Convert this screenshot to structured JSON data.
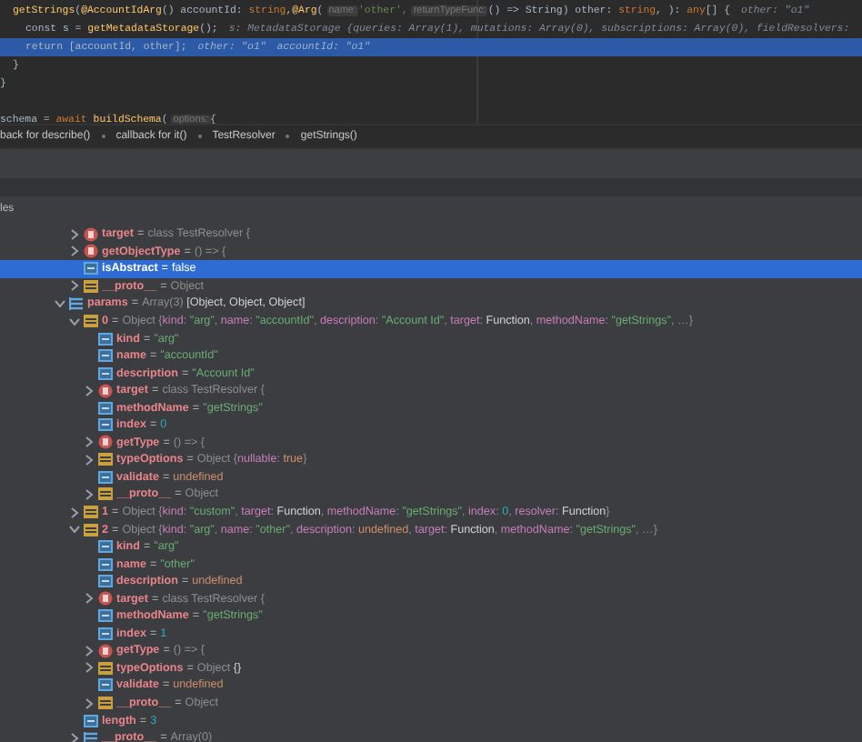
{
  "editor": {
    "lines": [
      {
        "current": false,
        "segments": [
          {
            "kind": "fn",
            "text": "getStrings"
          },
          {
            "kind": "plain",
            "text": "("
          },
          {
            "kind": "fn",
            "text": "@AccountIdArg"
          },
          {
            "kind": "plain",
            "text": "() accountId: "
          },
          {
            "kind": "kw",
            "text": "string"
          },
          {
            "kind": "plain",
            "text": ","
          },
          {
            "kind": "fn",
            "text": "@Arg"
          },
          {
            "kind": "plain",
            "text": "("
          },
          {
            "kind": "hint",
            "text": "name:"
          },
          {
            "kind": "str",
            "text": "'other',"
          },
          {
            "kind": "hint",
            "text": "returnTypeFunc:"
          },
          {
            "kind": "plain",
            "text": "() => String) other: "
          },
          {
            "kind": "kw",
            "text": "string"
          },
          {
            "kind": "plain",
            "text": ", ): "
          },
          {
            "kind": "kw",
            "text": "any"
          },
          {
            "kind": "plain",
            "text": "[] {"
          },
          {
            "kind": "inline",
            "text": "other: \"o1\""
          }
        ]
      },
      {
        "current": false,
        "segments": [
          {
            "kind": "plain",
            "text": "const s = "
          },
          {
            "kind": "fn",
            "text": "getMetadataStorage"
          },
          {
            "kind": "plain",
            "text": "();"
          },
          {
            "kind": "inline",
            "text": "s: MetadataStorage {queries: Array(1), mutations: Array(0), subscriptions: Array(0), fieldResolvers:"
          }
        ]
      },
      {
        "current": true,
        "segments": [
          {
            "kind": "plain",
            "text": "return [accountId, other];"
          },
          {
            "kind": "inline",
            "text": "other: \"o1\""
          },
          {
            "kind": "inline",
            "text": "accountId: \"o1\""
          }
        ]
      },
      {
        "current": false,
        "segments": [
          {
            "kind": "plain",
            "text": "}"
          }
        ]
      },
      {
        "current": false,
        "segments": [
          {
            "kind": "plain",
            "text": "}"
          }
        ]
      },
      {
        "current": false,
        "blank_before": true,
        "segments": [
          {
            "kind": "plain",
            "text": "schema = "
          },
          {
            "kind": "kw",
            "text": "await"
          },
          {
            "kind": "fn",
            "text": "buildSchema"
          },
          {
            "kind": "plain",
            "text": "("
          },
          {
            "kind": "hint",
            "text": "options:"
          },
          {
            "kind": "plain",
            "text": "{"
          }
        ]
      }
    ]
  },
  "breadcrumbs": [
    "back for describe()",
    "callback for it()",
    "TestResolver",
    "getStrings()"
  ],
  "panel_title": "les",
  "tree": {
    "continued": [
      {
        "name": "target",
        "kind": "function",
        "expanded": false,
        "selected": false,
        "value": [
          {
            "kind": "eq",
            "text": "="
          },
          {
            "kind": "dim",
            "text": "class TestResolver {"
          }
        ]
      },
      {
        "name": "getObjectType",
        "kind": "function",
        "expanded": false,
        "selected": false,
        "value": [
          {
            "kind": "eq",
            "text": "="
          },
          {
            "kind": "dim",
            "text": "() => {"
          }
        ]
      },
      {
        "name": "isAbstract",
        "kind": "field",
        "selected": true,
        "value": [
          {
            "kind": "eq",
            "text": "="
          },
          {
            "kind": "kw",
            "text": "false"
          }
        ]
      },
      {
        "name": "__proto__",
        "kind": "object",
        "expanded": false,
        "selected": false,
        "value": [
          {
            "kind": "eq",
            "text": "="
          },
          {
            "kind": "dim",
            "text": "Object"
          }
        ]
      }
    ],
    "items": [
      {
        "name": "params",
        "kind": "array",
        "expanded": true,
        "selected": false,
        "value": [
          {
            "kind": "eq",
            "text": "="
          },
          {
            "kind": "dim",
            "text": "Array(3) "
          },
          {
            "kind": "plain",
            "text": "[Object, Object, Object]"
          }
        ],
        "children": [
          {
            "name": "0",
            "kind": "object",
            "expanded": true,
            "selected": false,
            "value": [
              {
                "kind": "eq",
                "text": "="
              },
              {
                "kind": "dim",
                "text": "Object {"
              },
              {
                "kind": "key",
                "text": "kind"
              },
              {
                "kind": "dim",
                "text": ": "
              },
              {
                "kind": "str",
                "text": "\"arg\""
              },
              {
                "kind": "dim",
                "text": ", "
              },
              {
                "kind": "key",
                "text": "name"
              },
              {
                "kind": "dim",
                "text": ": "
              },
              {
                "kind": "str",
                "text": "\"accountId\""
              },
              {
                "kind": "dim",
                "text": ", "
              },
              {
                "kind": "key",
                "text": "description"
              },
              {
                "kind": "dim",
                "text": ": "
              },
              {
                "kind": "str",
                "text": "\"Account Id\""
              },
              {
                "kind": "dim",
                "text": ", "
              },
              {
                "kind": "key",
                "text": "target"
              },
              {
                "kind": "dim",
                "text": ": "
              },
              {
                "kind": "plain",
                "text": "Function"
              },
              {
                "kind": "dim",
                "text": ", "
              },
              {
                "kind": "key",
                "text": "methodName"
              },
              {
                "kind": "dim",
                "text": ": "
              },
              {
                "kind": "str",
                "text": "\"getStrings\""
              },
              {
                "kind": "dim",
                "text": ", …}"
              }
            ],
            "children": [
              {
                "name": "kind",
                "kind": "field",
                "selected": false,
                "value": [
                  {
                    "kind": "eq",
                    "text": "="
                  },
                  {
                    "kind": "str",
                    "text": "\"arg\""
                  }
                ]
              },
              {
                "name": "name",
                "kind": "field",
                "selected": false,
                "value": [
                  {
                    "kind": "eq",
                    "text": "="
                  },
                  {
                    "kind": "str",
                    "text": "\"accountId\""
                  }
                ]
              },
              {
                "name": "description",
                "kind": "field",
                "selected": false,
                "value": [
                  {
                    "kind": "eq",
                    "text": "="
                  },
                  {
                    "kind": "str",
                    "text": "\"Account Id\""
                  }
                ]
              },
              {
                "name": "target",
                "kind": "function",
                "expanded": false,
                "selected": false,
                "value": [
                  {
                    "kind": "eq",
                    "text": "="
                  },
                  {
                    "kind": "dim",
                    "text": "class TestResolver {"
                  }
                ]
              },
              {
                "name": "methodName",
                "kind": "field",
                "selected": false,
                "value": [
                  {
                    "kind": "eq",
                    "text": "="
                  },
                  {
                    "kind": "str",
                    "text": "\"getStrings\""
                  }
                ]
              },
              {
                "name": "index",
                "kind": "field",
                "selected": false,
                "value": [
                  {
                    "kind": "eq",
                    "text": "="
                  },
                  {
                    "kind": "num",
                    "text": "0"
                  }
                ]
              },
              {
                "name": "getType",
                "kind": "function",
                "expanded": false,
                "selected": false,
                "value": [
                  {
                    "kind": "eq",
                    "text": "="
                  },
                  {
                    "kind": "dim",
                    "text": "() => {"
                  }
                ]
              },
              {
                "name": "typeOptions",
                "kind": "object",
                "expanded": false,
                "selected": false,
                "value": [
                  {
                    "kind": "eq",
                    "text": "="
                  },
                  {
                    "kind": "dim",
                    "text": "Object {"
                  },
                  {
                    "kind": "key",
                    "text": "nullable"
                  },
                  {
                    "kind": "dim",
                    "text": ": "
                  },
                  {
                    "kind": "kw",
                    "text": "true"
                  },
                  {
                    "kind": "dim",
                    "text": "}"
                  }
                ]
              },
              {
                "name": "validate",
                "kind": "field",
                "selected": false,
                "value": [
                  {
                    "kind": "eq",
                    "text": "="
                  },
                  {
                    "kind": "kw",
                    "text": "undefined"
                  }
                ]
              },
              {
                "name": "__proto__",
                "kind": "object",
                "expanded": false,
                "selected": false,
                "value": [
                  {
                    "kind": "eq",
                    "text": "="
                  },
                  {
                    "kind": "dim",
                    "text": "Object"
                  }
                ]
              }
            ]
          },
          {
            "name": "1",
            "kind": "object",
            "expanded": false,
            "selected": false,
            "value": [
              {
                "kind": "eq",
                "text": "="
              },
              {
                "kind": "dim",
                "text": "Object {"
              },
              {
                "kind": "key",
                "text": "kind"
              },
              {
                "kind": "dim",
                "text": ": "
              },
              {
                "kind": "str",
                "text": "\"custom\""
              },
              {
                "kind": "dim",
                "text": ", "
              },
              {
                "kind": "key",
                "text": "target"
              },
              {
                "kind": "dim",
                "text": ": "
              },
              {
                "kind": "plain",
                "text": "Function"
              },
              {
                "kind": "dim",
                "text": ", "
              },
              {
                "kind": "key",
                "text": "methodName"
              },
              {
                "kind": "dim",
                "text": ": "
              },
              {
                "kind": "str",
                "text": "\"getStrings\""
              },
              {
                "kind": "dim",
                "text": ", "
              },
              {
                "kind": "key",
                "text": "index"
              },
              {
                "kind": "dim",
                "text": ": "
              },
              {
                "kind": "num",
                "text": "0"
              },
              {
                "kind": "dim",
                "text": ", "
              },
              {
                "kind": "key",
                "text": "resolver"
              },
              {
                "kind": "dim",
                "text": ": "
              },
              {
                "kind": "plain",
                "text": "Function"
              },
              {
                "kind": "dim",
                "text": "}"
              }
            ]
          },
          {
            "name": "2",
            "kind": "object",
            "expanded": true,
            "selected": false,
            "value": [
              {
                "kind": "eq",
                "text": "="
              },
              {
                "kind": "dim",
                "text": "Object {"
              },
              {
                "kind": "key",
                "text": "kind"
              },
              {
                "kind": "dim",
                "text": ": "
              },
              {
                "kind": "str",
                "text": "\"arg\""
              },
              {
                "kind": "dim",
                "text": ", "
              },
              {
                "kind": "key",
                "text": "name"
              },
              {
                "kind": "dim",
                "text": ": "
              },
              {
                "kind": "str",
                "text": "\"other\""
              },
              {
                "kind": "dim",
                "text": ", "
              },
              {
                "kind": "key",
                "text": "description"
              },
              {
                "kind": "dim",
                "text": ": "
              },
              {
                "kind": "kw",
                "text": "undefined"
              },
              {
                "kind": "dim",
                "text": ", "
              },
              {
                "kind": "key",
                "text": "target"
              },
              {
                "kind": "dim",
                "text": ": "
              },
              {
                "kind": "plain",
                "text": "Function"
              },
              {
                "kind": "dim",
                "text": ", "
              },
              {
                "kind": "key",
                "text": "methodName"
              },
              {
                "kind": "dim",
                "text": ": "
              },
              {
                "kind": "str",
                "text": "\"getStrings\""
              },
              {
                "kind": "dim",
                "text": ", …}"
              }
            ],
            "children": [
              {
                "name": "kind",
                "kind": "field",
                "selected": false,
                "value": [
                  {
                    "kind": "eq",
                    "text": "="
                  },
                  {
                    "kind": "str",
                    "text": "\"arg\""
                  }
                ]
              },
              {
                "name": "name",
                "kind": "field",
                "selected": false,
                "value": [
                  {
                    "kind": "eq",
                    "text": "="
                  },
                  {
                    "kind": "str",
                    "text": "\"other\""
                  }
                ]
              },
              {
                "name": "description",
                "kind": "field",
                "selected": false,
                "value": [
                  {
                    "kind": "eq",
                    "text": "="
                  },
                  {
                    "kind": "kw",
                    "text": "undefined"
                  }
                ]
              },
              {
                "name": "target",
                "kind": "function",
                "expanded": false,
                "selected": false,
                "value": [
                  {
                    "kind": "eq",
                    "text": "="
                  },
                  {
                    "kind": "dim",
                    "text": "class TestResolver {"
                  }
                ]
              },
              {
                "name": "methodName",
                "kind": "field",
                "selected": false,
                "value": [
                  {
                    "kind": "eq",
                    "text": "="
                  },
                  {
                    "kind": "str",
                    "text": "\"getStrings\""
                  }
                ]
              },
              {
                "name": "index",
                "kind": "field",
                "selected": false,
                "value": [
                  {
                    "kind": "eq",
                    "text": "="
                  },
                  {
                    "kind": "num",
                    "text": "1"
                  }
                ]
              },
              {
                "name": "getType",
                "kind": "function",
                "expanded": false,
                "selected": false,
                "value": [
                  {
                    "kind": "eq",
                    "text": "="
                  },
                  {
                    "kind": "dim",
                    "text": "() => {"
                  }
                ]
              },
              {
                "name": "typeOptions",
                "kind": "object",
                "expanded": false,
                "selected": false,
                "value": [
                  {
                    "kind": "eq",
                    "text": "="
                  },
                  {
                    "kind": "dim",
                    "text": "Object "
                  },
                  {
                    "kind": "plain",
                    "text": "{}"
                  }
                ]
              },
              {
                "name": "validate",
                "kind": "field",
                "selected": false,
                "value": [
                  {
                    "kind": "eq",
                    "text": "="
                  },
                  {
                    "kind": "kw",
                    "text": "undefined"
                  }
                ]
              },
              {
                "name": "__proto__",
                "kind": "object",
                "expanded": false,
                "selected": false,
                "value": [
                  {
                    "kind": "eq",
                    "text": "="
                  },
                  {
                    "kind": "dim",
                    "text": "Object"
                  }
                ]
              }
            ]
          },
          {
            "name": "length",
            "kind": "field",
            "selected": false,
            "value": [
              {
                "kind": "eq",
                "text": "="
              },
              {
                "kind": "num",
                "text": "3"
              }
            ]
          },
          {
            "name": "__proto__",
            "kind": "array",
            "expanded": false,
            "selected": false,
            "value": [
              {
                "kind": "eq",
                "text": "="
              },
              {
                "kind": "dim",
                "text": "Array(0)"
              }
            ]
          }
        ]
      }
    ]
  }
}
